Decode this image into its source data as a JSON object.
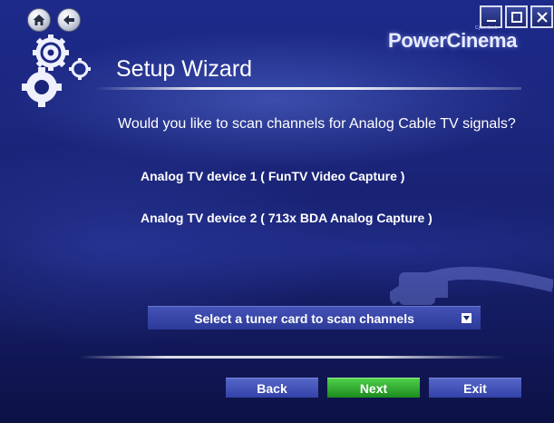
{
  "window": {
    "brand_small": "CyberLink",
    "brand": "PowerCinema",
    "controls": {
      "minimize": "minimize-icon",
      "maximize": "maximize-icon",
      "close": "close-icon"
    },
    "nav_icons": [
      "home-icon",
      "back-arrow-icon"
    ]
  },
  "wizard": {
    "title": "Setup Wizard",
    "question": "Would you like to scan channels for Analog Cable TV signals?",
    "devices": [
      "Analog TV device 1 ( FunTV Video Capture )",
      "Analog TV device 2 ( 713x BDA Analog Capture )"
    ],
    "tuner_select": {
      "label": "Select a tuner card to scan channels",
      "icon": "dropdown-arrow-icon"
    }
  },
  "buttons": {
    "back": "Back",
    "next": "Next",
    "exit": "Exit"
  },
  "colors": {
    "background": "#1a2478",
    "next_button": "#2eaa2c",
    "button": "#3f4fb8"
  }
}
